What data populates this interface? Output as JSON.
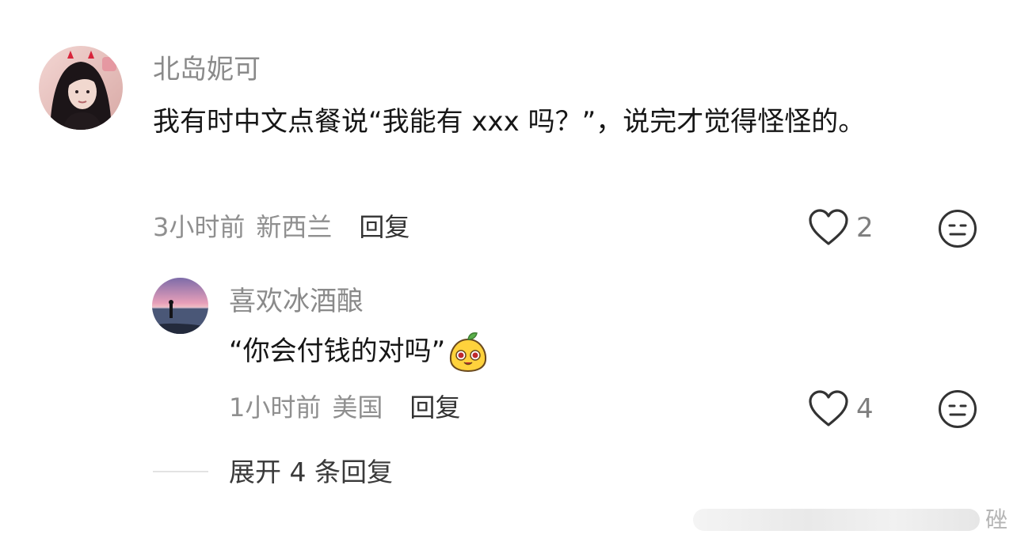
{
  "comments": [
    {
      "username": "北岛妮可",
      "text": "我有时中文点餐说“我能有 xxx 吗？”，说完才觉得怪怪的。",
      "time": "3小时前",
      "location": "新西兰",
      "reply_label": "回复",
      "like_count": "2",
      "like_icon": "heart-outline-icon",
      "reaction_icon": "neutral-face-icon"
    }
  ],
  "replies": [
    {
      "username": "喜欢冰酒酿",
      "text": "“你会付钱的对吗”",
      "emoji": "cartoon-mango-face-emoji",
      "time": "1小时前",
      "location": "美国",
      "reply_label": "回复",
      "like_count": "4",
      "like_icon": "heart-outline-icon",
      "reaction_icon": "neutral-face-icon"
    }
  ],
  "expand_replies_label": "展开 4 条回复",
  "watermark": {
    "text": "䂳"
  },
  "colors": {
    "username": "#8a8a8a",
    "text": "#161616",
    "meta": "#8f8f8f",
    "icon": "#333333"
  }
}
